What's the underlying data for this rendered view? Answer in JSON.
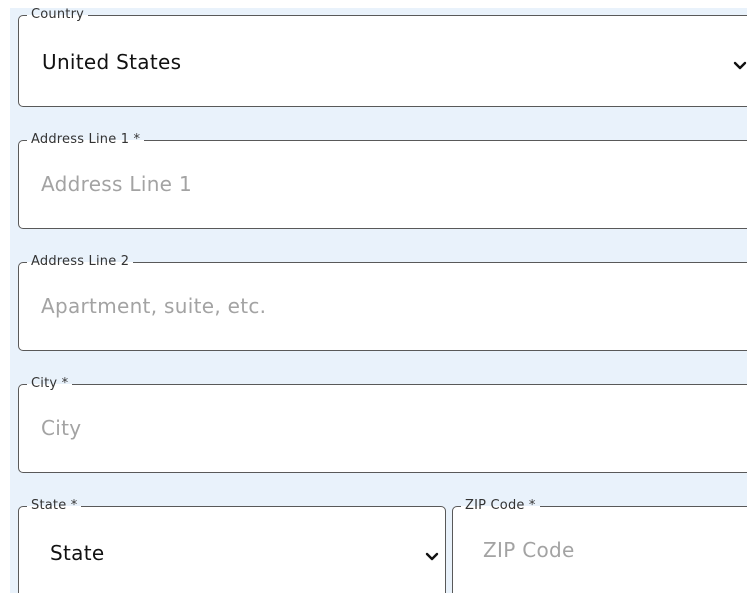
{
  "form": {
    "country": {
      "label": "Country",
      "value": "United States",
      "icon": "chevron-down-icon"
    },
    "address_line_1": {
      "label": "Address Line 1 *",
      "placeholder": "Address Line 1"
    },
    "address_line_2": {
      "label": "Address Line 2",
      "placeholder": "Apartment, suite, etc."
    },
    "city": {
      "label": "City *",
      "placeholder": "City"
    },
    "state": {
      "label": "State *",
      "value": "State",
      "icon": "chevron-down-icon"
    },
    "zip": {
      "label": "ZIP Code *",
      "placeholder": "ZIP Code"
    }
  },
  "colors": {
    "panel_background": "#e9f2fb",
    "border": "#595959",
    "placeholder": "#a3a3a3"
  }
}
